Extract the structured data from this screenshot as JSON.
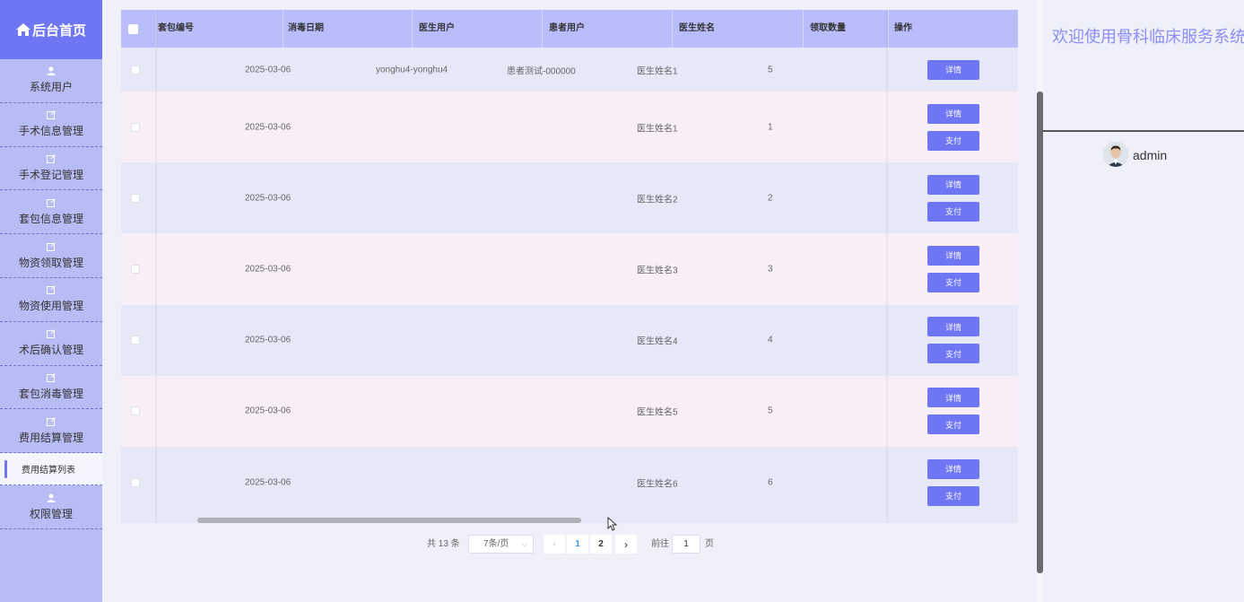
{
  "sidebar": {
    "brand": "后台首页",
    "items": [
      {
        "label": "系统用户",
        "icon": "user-icon"
      },
      {
        "label": "手术信息管理",
        "icon": "edit-icon"
      },
      {
        "label": "手术登记管理",
        "icon": "edit-icon"
      },
      {
        "label": "套包信息管理",
        "icon": "edit-icon"
      },
      {
        "label": "物资领取管理",
        "icon": "edit-icon"
      },
      {
        "label": "物资使用管理",
        "icon": "edit-icon"
      },
      {
        "label": "术后确认管理",
        "icon": "edit-icon"
      },
      {
        "label": "套包消毒管理",
        "icon": "edit-icon"
      },
      {
        "label": "费用结算管理",
        "icon": "edit-icon"
      }
    ],
    "active_sub": "费用结算列表",
    "last_item": {
      "label": "权限管理",
      "icon": "user-icon"
    }
  },
  "table": {
    "headers": [
      "套包编号",
      "消毒日期",
      "医生用户",
      "患者用户",
      "医生姓名",
      "领取数量",
      "操作"
    ],
    "rows": [
      {
        "date": "2025-03-06",
        "doctor_user": "yonghu4-yonghu4",
        "patient_user": "患者测试-000000",
        "doctor_name": "医生姓名1",
        "qty": "5",
        "pay": false
      },
      {
        "date": "2025-03-06",
        "doctor_user": "",
        "patient_user": "",
        "doctor_name": "医生姓名1",
        "qty": "1",
        "pay": true
      },
      {
        "date": "2025-03-06",
        "doctor_user": "",
        "patient_user": "",
        "doctor_name": "医生姓名2",
        "qty": "2",
        "pay": true
      },
      {
        "date": "2025-03-06",
        "doctor_user": "",
        "patient_user": "",
        "doctor_name": "医生姓名3",
        "qty": "3",
        "pay": true
      },
      {
        "date": "2025-03-06",
        "doctor_user": "",
        "patient_user": "",
        "doctor_name": "医生姓名4",
        "qty": "4",
        "pay": true
      },
      {
        "date": "2025-03-06",
        "doctor_user": "",
        "patient_user": "",
        "doctor_name": "医生姓名5",
        "qty": "5",
        "pay": true
      },
      {
        "date": "2025-03-06",
        "doctor_user": "",
        "patient_user": "",
        "doctor_name": "医生姓名6",
        "qty": "6",
        "pay": true
      }
    ],
    "detail_label": "详情",
    "pay_label": "支付"
  },
  "pagination": {
    "total": "共 13 条",
    "page_size": "7条/页",
    "pages": [
      "1",
      "2"
    ],
    "current": "1",
    "goto_label": "前往",
    "goto_value": "1",
    "goto_suffix": "页"
  },
  "right": {
    "welcome": "欢迎使用骨科临床服务系统",
    "username": "admin"
  },
  "colors": {
    "accent": "#6f76f4",
    "sidebar": "#b8bcf4",
    "header": "#babdfb"
  }
}
